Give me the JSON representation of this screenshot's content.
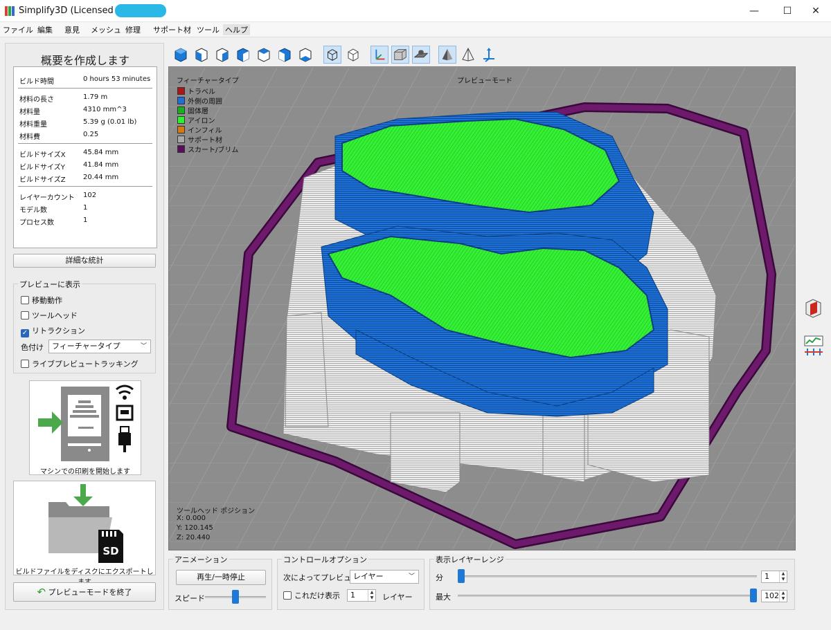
{
  "window": {
    "title": "Simplify3D (Licensed to",
    "controls": {
      "minimize": "—",
      "maximize": "☐",
      "close": "✕"
    }
  },
  "menu": [
    "ファイル",
    "編集",
    "意見",
    "メッシュ",
    "修理",
    "サポート材",
    "ツール",
    "ヘルプ"
  ],
  "summary": {
    "title": "概要を作成します",
    "stats": [
      {
        "key": "ビルド時間",
        "value": "0 hours 53 minutes"
      },
      {
        "key": "材料の長さ",
        "value": "1.79 m"
      },
      {
        "key": "材料量",
        "value": "4310 mm^3"
      },
      {
        "key": "材料重量",
        "value": "5.39 g (0.01 lb)"
      },
      {
        "key": "材料費",
        "value": "0.25"
      },
      {
        "key": "ビルドサイズX",
        "value": "45.84 mm"
      },
      {
        "key": "ビルドサイズY",
        "value": "41.84 mm"
      },
      {
        "key": "ビルドサイズZ",
        "value": "20.44 mm"
      },
      {
        "key": "レイヤーカウント",
        "value": "102"
      },
      {
        "key": "モデル数",
        "value": "1"
      },
      {
        "key": "プロセス数",
        "value": "1"
      }
    ],
    "details_button": "詳細な統計"
  },
  "preview_display": {
    "label": "プレビューに表示",
    "options": [
      {
        "label": "移動動作",
        "checked": false
      },
      {
        "label": "ツールヘッド",
        "checked": false
      },
      {
        "label": "リトラクション",
        "checked": true
      }
    ],
    "color_label": "色付け",
    "color_value": "フィーチャータイプ",
    "live_tracking": {
      "label": "ライブプレビュートラッキング",
      "checked": false
    }
  },
  "print_card": {
    "caption": "マシンでの印刷を開始します"
  },
  "export_card": {
    "caption": "ビルドファイルをディスクにエクスポートします",
    "sd_label": "SD"
  },
  "exit_button": "プレビューモードを終了",
  "viewport": {
    "legend_title": "フィーチャータイプ",
    "mode_label": "プレビューモード",
    "legend": [
      {
        "label": "トラベル",
        "color": "#b01515"
      },
      {
        "label": "外側の周囲",
        "color": "#1f6fd6"
      },
      {
        "label": "固体層",
        "color": "#18b21f"
      },
      {
        "label": "アイロン",
        "color": "#2cf52c"
      },
      {
        "label": "インフィル",
        "color": "#d57a11"
      },
      {
        "label": "サポート材",
        "color": "#a8a8a8"
      },
      {
        "label": "スカート/ブリム",
        "color": "#5c0c5c"
      }
    ],
    "toolhead_title": "ツールヘッド ポジション",
    "toolhead": {
      "x": "X: 0.000",
      "y": "Y: 120.145",
      "z": "Z: 20.440"
    }
  },
  "animation": {
    "label": "アニメーション",
    "play_button": "再生/一時停止",
    "speed_label": "スピード",
    "speed": 0.5
  },
  "control": {
    "label": "コントロールオプション",
    "preview_by_label": "次によってプレビュー",
    "preview_by_value": "レイヤー",
    "only_label": "これだけ表示",
    "only_value": "1",
    "only_unit": "レイヤー"
  },
  "layer_range": {
    "label": "表示レイヤーレンジ",
    "min_label": "分",
    "min_value": "1",
    "max_label": "最大",
    "max_value": "102",
    "layer_count": 102
  },
  "colors": {
    "accent": "#1e78d6",
    "perimeter": "#1f6fd6",
    "ironing": "#2cf52c",
    "support": "#d8d8d8",
    "skirt": "#5c0c5c"
  }
}
